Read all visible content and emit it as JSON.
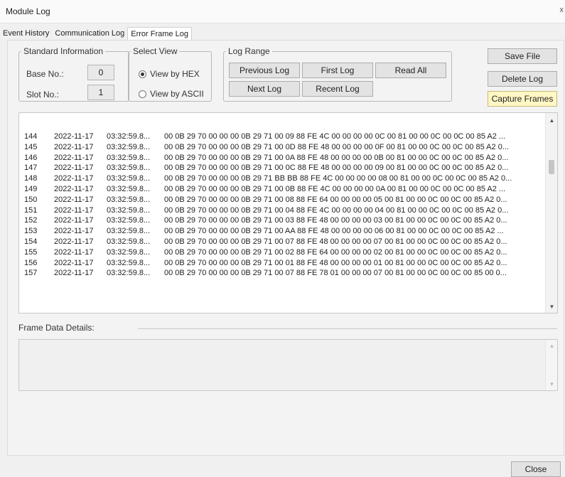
{
  "window": {
    "title": "Module Log",
    "close_glyph": "x"
  },
  "tabs": [
    {
      "label": "Event History",
      "active": false
    },
    {
      "label": "Communication Log",
      "active": false
    },
    {
      "label": "Error Frame Log",
      "active": true
    }
  ],
  "standard_info": {
    "legend": "Standard Information",
    "base_label": "Base No.:",
    "base_value": "0",
    "slot_label": "Slot No.:",
    "slot_value": "1"
  },
  "select_view": {
    "legend": "Select View",
    "hex_label": "View by HEX",
    "ascii_label": "View by ASCII",
    "selected": "hex"
  },
  "log_range": {
    "legend": "Log Range",
    "previous": "Previous Log",
    "first": "First Log",
    "read_all": "Read All",
    "next": "Next Log",
    "recent": "Recent Log"
  },
  "actions": {
    "save": "Save File",
    "delete": "Delete Log",
    "capture": "Capture Frames"
  },
  "log_rows": [
    {
      "no": "144",
      "date": "2022-11-17",
      "time": "03:32:59.8...",
      "data": "00 0B 29 70 00 00 00 0B 29 71 00 09 88 FE 4C 00 00 00 00 0C 00 81 00 00 0C 00 0C 00 85 A2 ..."
    },
    {
      "no": "145",
      "date": "2022-11-17",
      "time": "03:32:59.8...",
      "data": "00 0B 29 70 00 00 00 0B 29 71 00 0D 88 FE 48 00 00 00 00 0F 00 81 00 00 0C 00 0C 00 85 A2 0..."
    },
    {
      "no": "146",
      "date": "2022-11-17",
      "time": "03:32:59.8...",
      "data": "00 0B 29 70 00 00 00 0B 29 71 00 0A 88 FE 48 00 00 00 00 0B 00 81 00 00 0C 00 0C 00 85 A2 0..."
    },
    {
      "no": "147",
      "date": "2022-11-17",
      "time": "03:32:59.8...",
      "data": "00 0B 29 70 00 00 00 0B 29 71 00 0C 88 FE 48 00 00 00 00 09 00 81 00 00 0C 00 0C 00 85 A2 0..."
    },
    {
      "no": "148",
      "date": "2022-11-17",
      "time": "03:32:59.8...",
      "data": "00 0B 29 70 00 00 00 0B 29 71 BB BB 88 FE 4C 00 00 00 00 08 00 81 00 00 0C 00 0C 00 85 A2 0..."
    },
    {
      "no": "149",
      "date": "2022-11-17",
      "time": "03:32:59.8...",
      "data": "00 0B 29 70 00 00 00 0B 29 71 00 0B 88 FE 4C 00 00 00 00 0A 00 81 00 00 0C 00 0C 00 85 A2 ..."
    },
    {
      "no": "150",
      "date": "2022-11-17",
      "time": "03:32:59.8...",
      "data": "00 0B 29 70 00 00 00 0B 29 71 00 08 88 FE 64 00 00 00 00 05 00 81 00 00 0C 00 0C 00 85 A2 0..."
    },
    {
      "no": "151",
      "date": "2022-11-17",
      "time": "03:32:59.8...",
      "data": "00 0B 29 70 00 00 00 0B 29 71 00 04 88 FE 4C 00 00 00 00 04 00 81 00 00 0C 00 0C 00 85 A2 0..."
    },
    {
      "no": "152",
      "date": "2022-11-17",
      "time": "03:32:59.8...",
      "data": "00 0B 29 70 00 00 00 0B 29 71 00 03 88 FE 48 00 00 00 00 03 00 81 00 00 0C 00 0C 00 85 A2 0..."
    },
    {
      "no": "153",
      "date": "2022-11-17",
      "time": "03:32:59.8...",
      "data": "00 0B 29 70 00 00 00 0B 29 71 00 AA 88 FE 48 00 00 00 00 06 00 81 00 00 0C 00 0C 00 85 A2 ..."
    },
    {
      "no": "154",
      "date": "2022-11-17",
      "time": "03:32:59.8...",
      "data": "00 0B 29 70 00 00 00 0B 29 71 00 07 88 FE 48 00 00 00 00 07 00 81 00 00 0C 00 0C 00 85 A2 0..."
    },
    {
      "no": "155",
      "date": "2022-11-17",
      "time": "03:32:59.8...",
      "data": "00 0B 29 70 00 00 00 0B 29 71 00 02 88 FE 64 00 00 00 00 02 00 81 00 00 0C 00 0C 00 85 A2 0..."
    },
    {
      "no": "156",
      "date": "2022-11-17",
      "time": "03:32:59.8...",
      "data": "00 0B 29 70 00 00 00 0B 29 71 00 01 88 FE 48 00 00 00 00 01 00 81 00 00 0C 00 0C 00 85 A2 0..."
    },
    {
      "no": "157",
      "date": "2022-11-17",
      "time": "03:32:59.8...",
      "data": "00 0B 29 70 00 00 00 0B 29 71 00 07 88 FE 78 01 00 00 00 07 00 81 00 00 0C 00 0C 00 85 00 0..."
    }
  ],
  "frame_details": {
    "label": "Frame Data Details:",
    "content": ""
  },
  "footer": {
    "close": "Close"
  },
  "icons": {
    "scroll_up": "up-arrow-icon",
    "scroll_down": "down-arrow-icon"
  }
}
